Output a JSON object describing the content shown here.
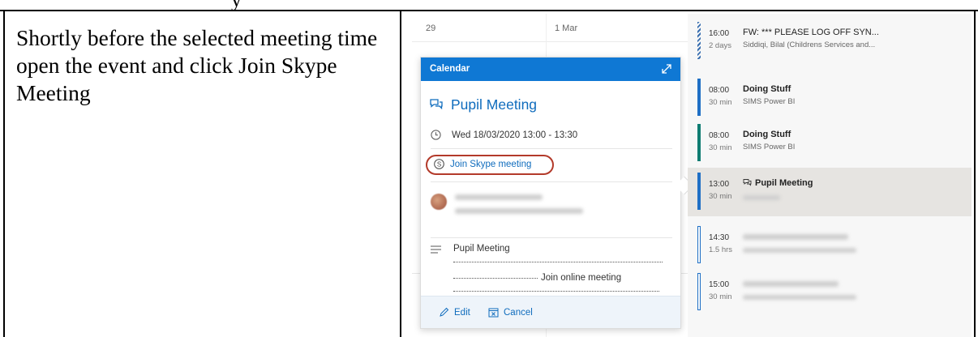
{
  "top_fragment": "y",
  "instruction": "Shortly before the selected meeting time open the event and click Join Skype Meeting",
  "calendar_grid": {
    "date_left": "29",
    "date_right": "1 Mar"
  },
  "popup": {
    "header_title": "Calendar",
    "title": "Pupil Meeting",
    "time": "Wed 18/03/2020 13:00 - 13:30",
    "join_link": "Join Skype meeting",
    "description_title": "Pupil Meeting",
    "join_online": "Join online meeting",
    "edit_label": "Edit",
    "cancel_label": "Cancel",
    "accent_color": "#0f78d4"
  },
  "agenda": [
    {
      "time": "16:00",
      "duration": "2 days",
      "title": "FW: *** PLEASE LOG OFF SYN...",
      "subtitle": "Siddiqi, Bilal (Childrens Services and..."
    },
    {
      "time": "08:00",
      "duration": "30 min",
      "title": "Doing Stuff",
      "subtitle": "SIMS Power BI"
    },
    {
      "time": "08:00",
      "duration": "30 min",
      "title": "Doing Stuff",
      "subtitle": "SIMS Power BI"
    },
    {
      "time": "13:00",
      "duration": "30 min",
      "title": "Pupil Meeting",
      "subtitle": ""
    },
    {
      "time": "14:30",
      "duration": "1.5 hrs",
      "title": "",
      "subtitle": ""
    },
    {
      "time": "15:00",
      "duration": "30 min",
      "title": "",
      "subtitle": ""
    }
  ]
}
